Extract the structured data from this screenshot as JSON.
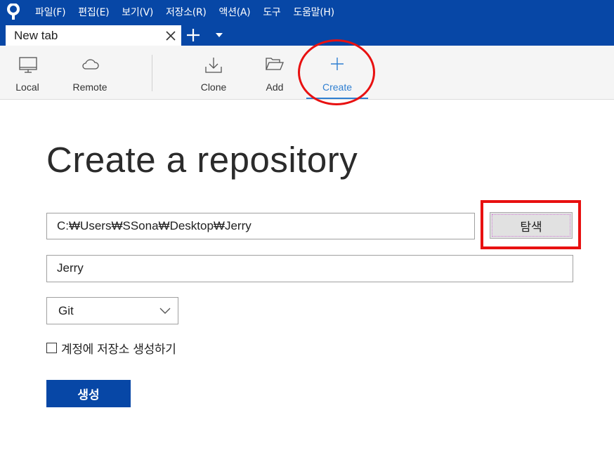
{
  "menu": {
    "items": [
      "파일(F)",
      "편집(E)",
      "보기(V)",
      "저장소(R)",
      "액션(A)",
      "도구",
      "도움말(H)"
    ]
  },
  "tabs": {
    "active_label": "New tab"
  },
  "toolbar": {
    "local": "Local",
    "remote": "Remote",
    "clone": "Clone",
    "add": "Add",
    "create": "Create"
  },
  "main": {
    "title": "Create a repository",
    "destination_path": "C:₩Users₩SSona₩Desktop₩Jerry",
    "browse_label": "탐색",
    "repo_name": "Jerry",
    "vcs_type": "Git",
    "create_account_repo_label": "계정에 저장소 생성하기",
    "create_label": "생성"
  },
  "colors": {
    "brand_blue": "#0747a6",
    "active_blue": "#2f7fd1",
    "annotation_red": "#e81010"
  },
  "icons": [
    "app-logo",
    "close-icon",
    "plus-icon",
    "chevron-down-icon",
    "monitor-icon",
    "cloud-icon",
    "download-icon",
    "folder-open-icon",
    "plus-icon"
  ]
}
